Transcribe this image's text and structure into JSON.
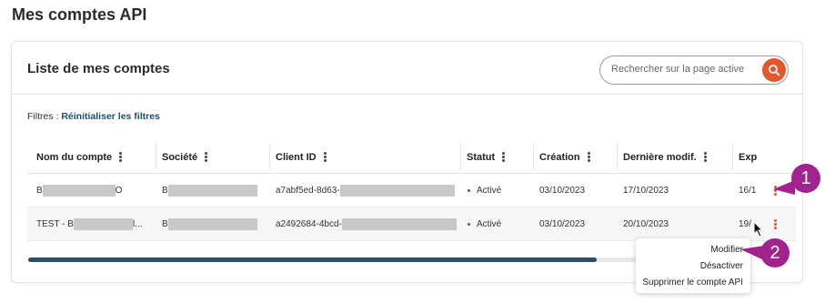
{
  "page": {
    "title": "Mes comptes API"
  },
  "card": {
    "title": "Liste de mes comptes"
  },
  "search": {
    "placeholder": "Rechercher sur la page active",
    "icon": "search-icon",
    "accent": "#e4562c"
  },
  "filters": {
    "label": "Filtres :",
    "reset_label": "Réinitialiser les filtres"
  },
  "table": {
    "columns": [
      "Nom du compte",
      "Société",
      "Client ID",
      "Statut",
      "Création",
      "Dernière modif.",
      "Exp"
    ],
    "rows": [
      {
        "name_prefix": "B",
        "name_suffix": "O",
        "company_prefix": "B",
        "client_id_prefix": "a7abf5ed-8d63-",
        "status": "Activé",
        "created": "03/10/2023",
        "modified": "17/10/2023",
        "exp": "16/1"
      },
      {
        "name_prefix": "TEST - B",
        "name_suffix": "l...",
        "company_prefix": "B",
        "client_id_prefix": "a2492684-4bcd-",
        "status": "Activé",
        "created": "03/10/2023",
        "modified": "20/10/2023",
        "exp": "19/"
      }
    ],
    "status_color": "#2e7d32"
  },
  "scroll": {
    "position_percent": 82
  },
  "row_menu": {
    "items": [
      "Modifier",
      "Désactiver",
      "Supprimer le compte API"
    ]
  },
  "callouts": {
    "one": "1",
    "two": "2",
    "color": "#a1238e"
  }
}
